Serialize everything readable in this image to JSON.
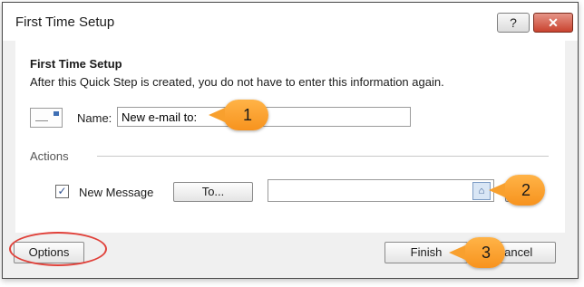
{
  "window": {
    "title": "First Time Setup",
    "help_label": "?",
    "close_label": "✕"
  },
  "setup": {
    "heading": "First Time Setup",
    "description": "After this Quick Step is created, you do not have to enter this information again."
  },
  "name_field": {
    "label": "Name:",
    "value": "New e-mail to:"
  },
  "actions": {
    "label": "Actions",
    "new_message": {
      "label": "New Message",
      "checked": true,
      "check_mark": "✓"
    },
    "to_button": "To...",
    "to_value": "",
    "address_book_icon": "address-book-icon",
    "address_book_glyph": "⌂"
  },
  "footer": {
    "options_label": "Options",
    "finish_label": "Finish",
    "cancel_label": "Cancel"
  },
  "callouts": [
    "1",
    "2",
    "3"
  ],
  "colors": {
    "callout": "#f7931e",
    "highlight_circle": "#e0413a",
    "close_button": "#c9432f"
  }
}
